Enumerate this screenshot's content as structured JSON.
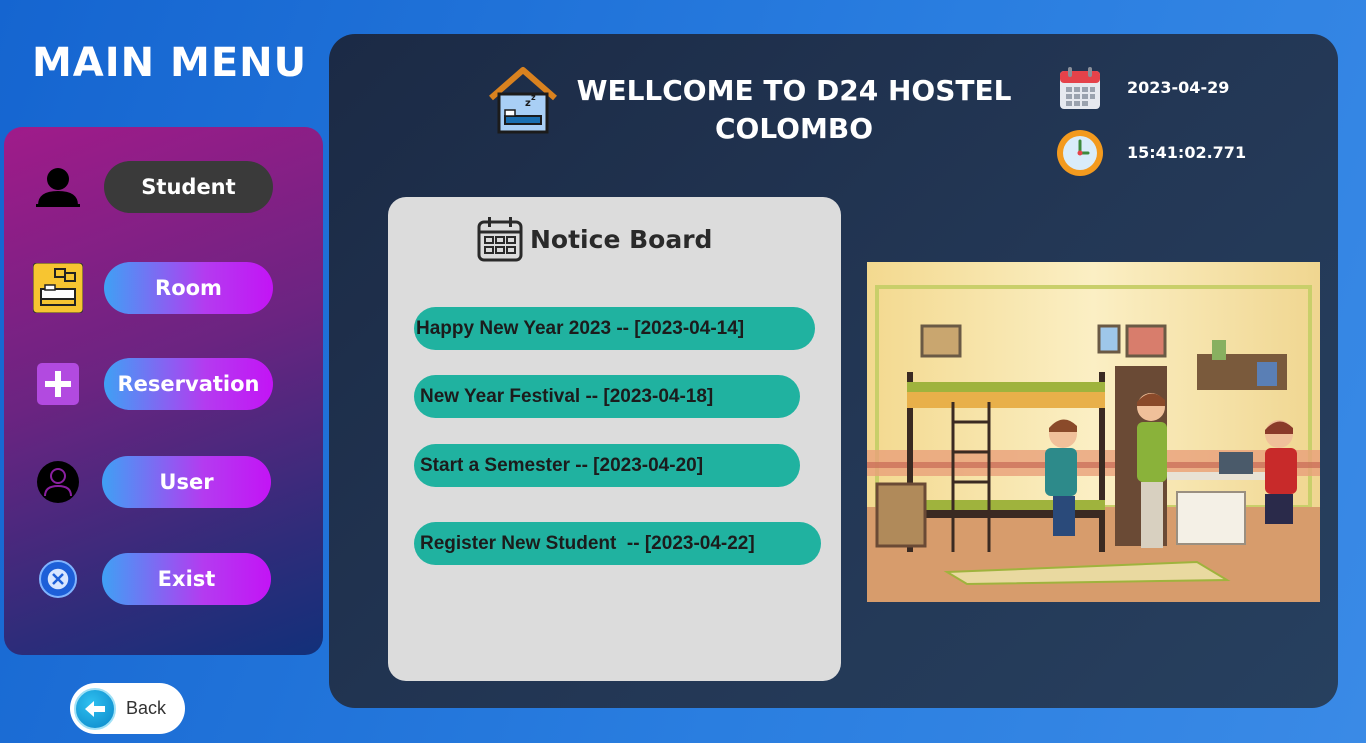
{
  "sidebar": {
    "title": "MAIN MENU",
    "items": [
      {
        "label": "Student",
        "icon": "student-icon",
        "active": true
      },
      {
        "label": "Room",
        "icon": "bed-icon",
        "active": false
      },
      {
        "label": "Reservation",
        "icon": "plus-icon",
        "active": false
      },
      {
        "label": "User",
        "icon": "user-icon",
        "active": false
      },
      {
        "label": "Exist",
        "icon": "close-icon",
        "active": false
      }
    ],
    "back_label": "Back"
  },
  "header": {
    "title_line1": "WELLCOME  TO D24 HOSTEL",
    "title_line2": "COLOMBO",
    "date": "2023-04-29",
    "time": "15:41:02.771"
  },
  "notice_board": {
    "title": "Notice Board",
    "items": [
      "Happy New Year 2023 -- [2023-04-14]",
      "New Year Festival -- [2023-04-18]",
      "Start a Semester -- [2023-04-20]",
      "Register New Student  -- [2023-04-22]"
    ]
  },
  "colors": {
    "accent_teal": "#20b2a0",
    "button_gradient_start": "#3fa0f5",
    "button_gradient_end": "#c314f5",
    "active_button": "#3a3a3a"
  }
}
